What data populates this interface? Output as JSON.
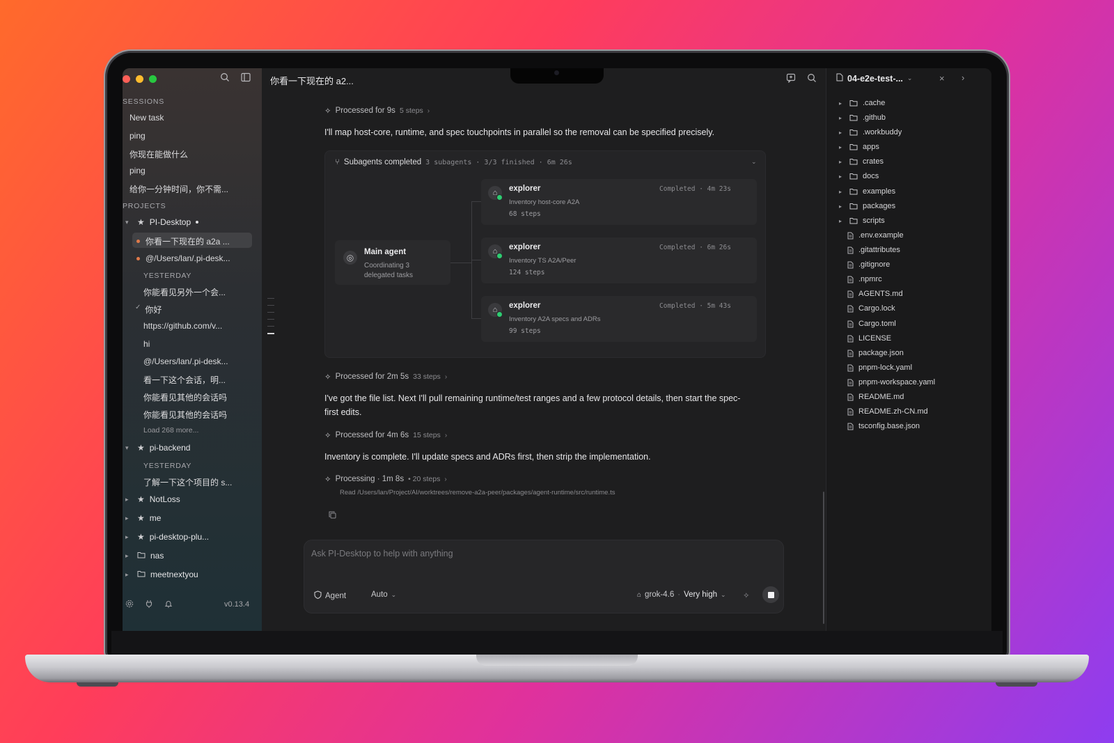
{
  "sidebar": {
    "sessions_label": "SESSIONS",
    "sessions": [
      "New task",
      "ping",
      "你现在能做什么",
      "ping",
      "给你一分钟时间，你不需..."
    ],
    "projects_label": "PROJECTS",
    "project_main": {
      "name": "PI-Desktop",
      "active_session": "你看一下现在的 a2a ...",
      "second_session": "@/Users/lan/.pi-desk...",
      "yesterday_label": "YESTERDAY",
      "older_sessions": [
        "你能看见另外一个会...",
        "你好",
        "https://github.com/v...",
        "hi",
        "@/Users/lan/.pi-desk...",
        "看一下这个会话，明...",
        "你能看见其他的会话吗",
        "你能看见其他的会话吗"
      ],
      "load_more": "Load 268 more..."
    },
    "project_backend": {
      "name": "pi-backend",
      "yesterday_label": "YESTERDAY",
      "session": "了解一下这个项目的 s..."
    },
    "other_projects": [
      {
        "name": "NotLoss",
        "icon": "star-icon"
      },
      {
        "name": "me",
        "icon": "star-icon"
      },
      {
        "name": "pi-desktop-plu...",
        "icon": "star-icon"
      },
      {
        "name": "nas",
        "icon": "folder-icon"
      },
      {
        "name": "meetnextyou",
        "icon": "folder-icon"
      }
    ],
    "version": "v0.13.4"
  },
  "main": {
    "title": "你看一下现在的 a2...",
    "proc1": {
      "label": "Processed for 9s",
      "steps": "5 steps"
    },
    "msg1": "I'll map host-core, runtime, and spec touchpoints in parallel so the removal can be specified precisely.",
    "subagents": {
      "title": "Subagents completed",
      "count": "3 subagents",
      "finished": "3/3 finished",
      "duration": "6m 26s",
      "main_agent": {
        "title": "Main agent",
        "desc": "Coordinating 3 delegated tasks"
      },
      "agents": [
        {
          "name": "explorer",
          "status": "Completed · 4m 23s",
          "desc": "Inventory host-core A2A",
          "steps": "68 steps"
        },
        {
          "name": "explorer",
          "status": "Completed · 6m 26s",
          "desc": "Inventory TS A2A/Peer",
          "steps": "124 steps"
        },
        {
          "name": "explorer",
          "status": "Completed · 5m 43s",
          "desc": "Inventory A2A specs and ADRs",
          "steps": "99 steps"
        }
      ]
    },
    "proc2": {
      "label": "Processed for 2m 5s",
      "steps": "33 steps"
    },
    "msg2": "I've got the file list. Next I'll pull remaining runtime/test ranges and a few protocol details, then start the spec-first edits.",
    "proc3": {
      "label": "Processed for 4m 6s",
      "steps": "15 steps"
    },
    "msg3": "Inventory is complete. I'll update specs and ADRs first, then strip the implementation.",
    "proc4": {
      "label": "Processing · 1m 8s",
      "steps": "• 20 steps"
    },
    "read_line": "Read /Users/lan/Project/AI/worktrees/remove-a2a-peer/packages/agent-runtime/src/runtime.ts",
    "composer": {
      "placeholder": "Ask PI-Desktop to help with anything",
      "agent_label": "Agent",
      "auto_label": "Auto",
      "model": "grok-4.6",
      "effort": "Very high"
    }
  },
  "files": {
    "title": "04-e2e-test-...",
    "folders": [
      ".cache",
      ".github",
      ".workbuddy",
      "apps",
      "crates",
      "docs",
      "examples",
      "packages",
      "scripts"
    ],
    "files": [
      ".env.example",
      ".gitattributes",
      ".gitignore",
      ".npmrc",
      "AGENTS.md",
      "Cargo.lock",
      "Cargo.toml",
      "LICENSE",
      "package.json",
      "pnpm-lock.yaml",
      "pnpm-workspace.yaml",
      "README.md",
      "README.zh-CN.md",
      "tsconfig.base.json"
    ]
  },
  "colors": {
    "background_start": "#ff6a2b",
    "background_end": "#8e3df0",
    "success_dot": "#2ecc71",
    "session_dot": "#e07a4a"
  }
}
